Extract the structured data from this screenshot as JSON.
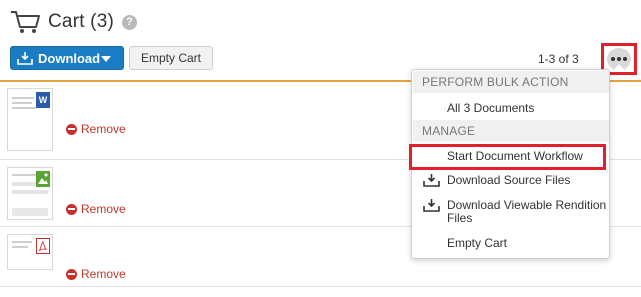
{
  "header": {
    "title": "Cart (3)",
    "help_glyph": "?"
  },
  "toolbar": {
    "download_label": "Download",
    "empty_cart_label": "Empty Cart",
    "count_text": "1-3 of 3"
  },
  "items": [
    {
      "type": "word",
      "badge": "W",
      "remove_label": "Remove"
    },
    {
      "type": "image",
      "badge": "",
      "remove_label": "Remove"
    },
    {
      "type": "pdf",
      "badge": "",
      "remove_label": "Remove"
    }
  ],
  "menu": {
    "section1": "PERFORM BULK ACTION",
    "all_docs": "All 3 Documents",
    "section2": "MANAGE",
    "start_workflow": "Start Document Workflow",
    "download_source": "Download Source Files",
    "download_viewable": "Download Viewable Rendition Files",
    "empty_cart": "Empty Cart"
  },
  "colors": {
    "primary": "#1a7dc4",
    "accent_line": "#e6a23c",
    "remove_red": "#c0392b",
    "highlight_red": "#e0202a"
  }
}
